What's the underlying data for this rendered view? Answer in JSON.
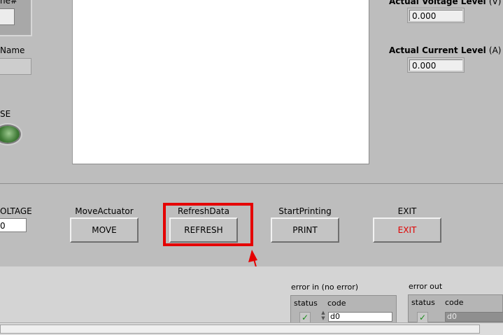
{
  "left_panel": {
    "number_label": "ne#",
    "name_label": "Name",
    "led_label": "SE"
  },
  "readouts": {
    "voltage": {
      "label": "Actual Voltage Level",
      "unit": "(V)",
      "value": "0.000"
    },
    "current": {
      "label": "Actual Current Level",
      "unit": "(A)",
      "value": "0.000"
    }
  },
  "controls": {
    "voltage": {
      "label": "OLTAGE",
      "value": "0"
    },
    "move": {
      "label": "MoveActuator",
      "button": "MOVE"
    },
    "refresh": {
      "label": "RefreshData",
      "button": "REFRESH"
    },
    "print": {
      "label": "StartPrinting",
      "button": "PRINT"
    },
    "exit": {
      "label": "EXIT",
      "button": "EXIT"
    }
  },
  "error_in": {
    "label": "error in (no error)",
    "status_label": "status",
    "code_label": "code",
    "code_value": "d0"
  },
  "error_out": {
    "label": "error out",
    "status_label": "status",
    "code_label": "code",
    "code_value": "d0"
  },
  "colors": {
    "panel": "#bdbdbd",
    "highlight": "#e50000",
    "exit_text": "#e10000",
    "status_check": "#1a8a1a"
  }
}
